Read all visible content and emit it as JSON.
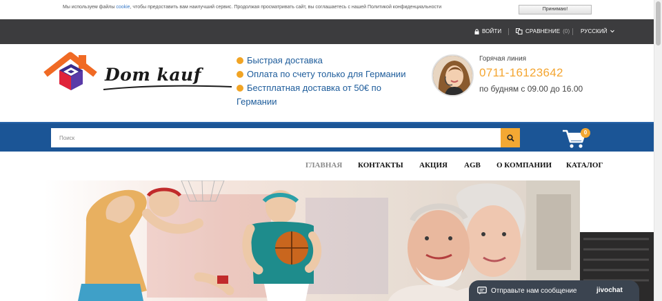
{
  "cookie": {
    "text_before": "Мы используем файлы ",
    "link": "cookie",
    "text_after": ", чтобы предоставить вам наилучший сервис. Продолжая просматривать сайт, вы соглашаетесь с нашей Политикой конфиденциальности",
    "accept_button": "Принимаю!"
  },
  "topbar": {
    "login": "ВОЙТИ",
    "compare": "СРАВНЕНИЕ",
    "compare_count": "(0)",
    "language": "РУССКИЙ"
  },
  "header": {
    "logo_text": "Dom kauf",
    "features": [
      "Быстрая доставка",
      "Оплата по счету только для Германии",
      "Бестплатная доставка от 50€ по"
    ],
    "feature_continuation": "Германии",
    "hotline_label": "Горячая линия",
    "phone": "0711-16123642",
    "hours": "по будням с 09.00 до 16.00"
  },
  "search": {
    "placeholder": "Поиск",
    "cart_count": "0"
  },
  "nav": {
    "items": [
      "ГЛАВНАЯ",
      "КОНТАКТЫ",
      "АКЦИЯ",
      "AGB",
      "О КОМПАНИИ",
      "КАТАЛОГ"
    ]
  },
  "chat": {
    "label": "Отправьте нам сообщение",
    "brand": "jivochat"
  },
  "colors": {
    "topbar": "#3c3c3e",
    "brand_blue": "#1b5596",
    "accent_orange": "#f3a833",
    "link_blue": "#1c5b9a"
  },
  "icons": [
    "lock-icon",
    "compare-icon",
    "chevron-down-icon",
    "search-icon",
    "cart-icon",
    "chat-icon"
  ]
}
